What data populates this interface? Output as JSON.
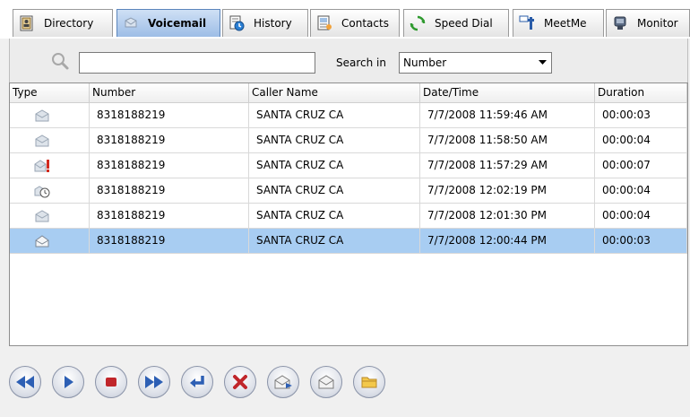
{
  "tabs": [
    {
      "label": "Directory",
      "icon": "directory-icon",
      "active": false
    },
    {
      "label": "Voicemail",
      "icon": "voicemail-icon",
      "active": true
    },
    {
      "label": "History",
      "icon": "history-icon",
      "active": false
    },
    {
      "label": "Contacts",
      "icon": "contacts-icon",
      "active": false
    },
    {
      "label": "Speed Dial",
      "icon": "speed-dial-icon",
      "active": false
    },
    {
      "label": "MeetMe",
      "icon": "meetme-icon",
      "active": false
    },
    {
      "label": "Monitor",
      "icon": "monitor-icon",
      "active": false
    }
  ],
  "search": {
    "value": "",
    "in_label": "Search in",
    "field_selected": "Number"
  },
  "table": {
    "columns": [
      "Type",
      "Number",
      "Caller Name",
      "Date/Time",
      "Duration"
    ],
    "rows": [
      {
        "type_icon": "voicemail-read-icon",
        "number": "8318188219",
        "caller": "SANTA CRUZ  CA",
        "datetime": "7/7/2008 11:59:46 AM",
        "duration": "00:00:03",
        "selected": false
      },
      {
        "type_icon": "voicemail-read-icon",
        "number": "8318188219",
        "caller": "SANTA CRUZ  CA",
        "datetime": "7/7/2008 11:58:50 AM",
        "duration": "00:00:04",
        "selected": false
      },
      {
        "type_icon": "voicemail-urgent-icon",
        "number": "8318188219",
        "caller": "SANTA CRUZ  CA",
        "datetime": "7/7/2008 11:57:29 AM",
        "duration": "00:00:07",
        "selected": false
      },
      {
        "type_icon": "voicemail-timed-icon",
        "number": "8318188219",
        "caller": "SANTA CRUZ  CA",
        "datetime": "7/7/2008 12:02:19 PM",
        "duration": "00:00:04",
        "selected": false
      },
      {
        "type_icon": "voicemail-read-icon",
        "number": "8318188219",
        "caller": "SANTA CRUZ  CA",
        "datetime": "7/7/2008 12:01:30 PM",
        "duration": "00:00:04",
        "selected": false
      },
      {
        "type_icon": "voicemail-new-icon",
        "number": "8318188219",
        "caller": "SANTA CRUZ  CA",
        "datetime": "7/7/2008 12:00:44 PM",
        "duration": "00:00:03",
        "selected": true
      }
    ]
  },
  "controls": [
    {
      "name": "rewind-button",
      "icon": "rewind-icon"
    },
    {
      "name": "play-button",
      "icon": "play-icon"
    },
    {
      "name": "stop-button",
      "icon": "stop-icon"
    },
    {
      "name": "fast-forward-button",
      "icon": "fast-forward-icon"
    },
    {
      "name": "call-back-button",
      "icon": "return-arrow-icon"
    },
    {
      "name": "delete-button",
      "icon": "delete-x-icon"
    },
    {
      "name": "forward-message-button",
      "icon": "envelope-forward-icon"
    },
    {
      "name": "mark-message-button",
      "icon": "envelope-icon"
    },
    {
      "name": "save-folder-button",
      "icon": "folder-icon"
    }
  ],
  "colors": {
    "selected_row": "#a8cdf2",
    "active_tab": "#9dbde6",
    "control_blue": "#2d5fb4",
    "control_red": "#c0262b",
    "folder_yellow": "#f3c84b"
  }
}
